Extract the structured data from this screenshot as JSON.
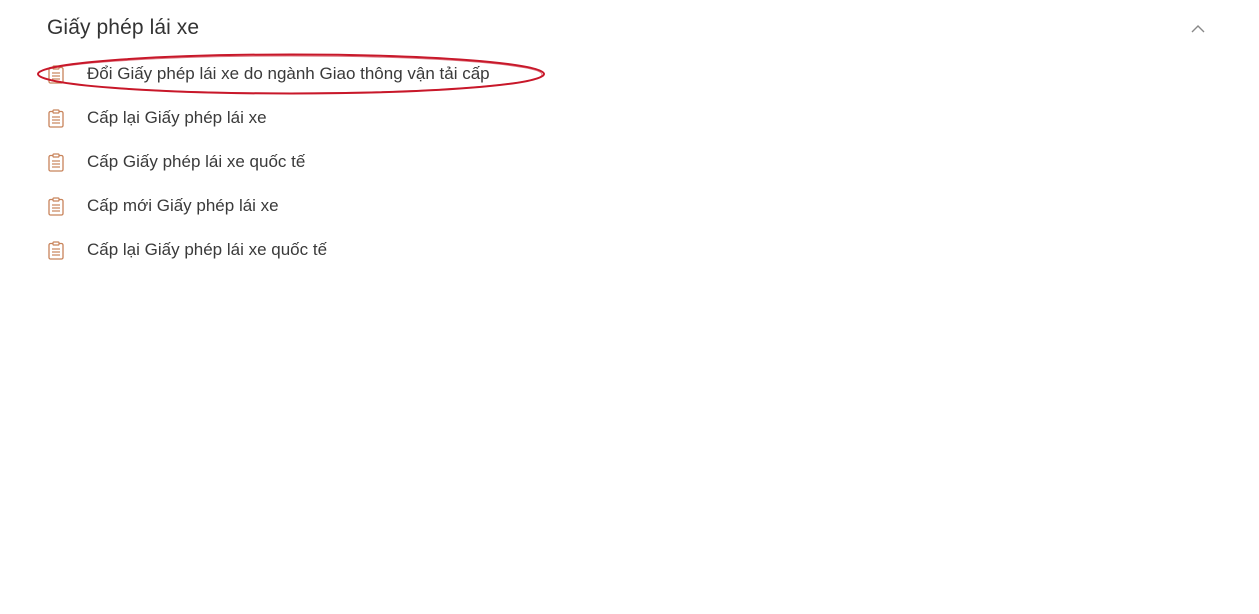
{
  "section": {
    "title": "Giấy phép lái xe",
    "expanded": true,
    "chevron_icon": "chevron-up-icon"
  },
  "items": [
    {
      "label": "Đổi Giấy phép lái xe do ngành Giao thông vận tải cấp",
      "icon": "document-list-icon",
      "highlighted": true
    },
    {
      "label": "Cấp lại Giấy phép lái xe",
      "icon": "document-list-icon"
    },
    {
      "label": "Cấp Giấy phép lái xe quốc tế",
      "icon": "document-list-icon"
    },
    {
      "label": "Cấp mới Giấy phép lái xe",
      "icon": "document-list-icon"
    },
    {
      "label": "Cấp lại Giấy phép lái xe quốc tế",
      "icon": "document-list-icon"
    }
  ],
  "colors": {
    "icon": "#c8835a",
    "annotation": "#c8182a",
    "text": "#333333"
  }
}
